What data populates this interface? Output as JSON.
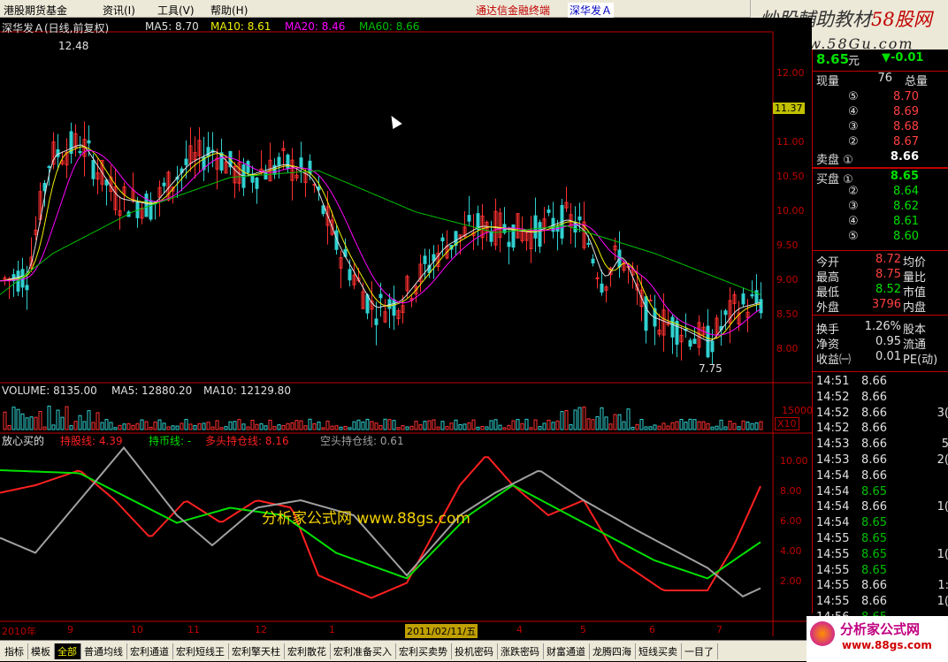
{
  "menu": {
    "items": [
      "港股期货基金",
      "资讯(I)",
      "工具(V)",
      "帮助(H)"
    ],
    "title_left": "通达信金融终端",
    "title_right": "深华发Ａ"
  },
  "brand": {
    "line1": "炒股輔助教材",
    "line2": "58股网",
    "url": "www.58Gu.com"
  },
  "header": {
    "stock": "深华发Ａ(日线,前复权)",
    "ma5": "MA5: 8.70",
    "ma10": "MA10: 8.61",
    "ma20": "MA20: 8.46",
    "ma60": "MA60: 8.66"
  },
  "price_axis": [
    "12.00",
    "11.50",
    "11.00",
    "10.50",
    "10.00",
    "9.50",
    "9.00",
    "8.50",
    "8.00"
  ],
  "price_current_tag": "11.37",
  "price_high": "12.48",
  "price_low": "7.75",
  "volume": {
    "label": "VOLUME: 8135.00",
    "ma5": "MA5: 12880.20",
    "ma10": "MA10: 12129.80",
    "axis": "15000",
    "unit": "X10"
  },
  "indicator": {
    "name": "放心买的",
    "l1": "持股线: 4.39",
    "l2": "持币线: -",
    "l3": "多头持仓线: 8.16",
    "l4": "空头持仓线: 0.61",
    "axis": [
      "10.00",
      "8.00",
      "6.00",
      "4.00",
      "2.00"
    ]
  },
  "watermark": {
    "text": "分析家公式网 www.88gs.com"
  },
  "date_label": "2011/02/11/五",
  "time_axis": [
    "2010年",
    "9",
    "10",
    "11",
    "12",
    "1",
    "3",
    "4",
    "5",
    "6",
    "7"
  ],
  "quote": {
    "price": "8.65",
    "unit": "元",
    "change": "▼-0.01",
    "head": [
      "现量",
      "76",
      "总量"
    ],
    "sell": [
      {
        "n": "⑤",
        "p": "8.70"
      },
      {
        "n": "④",
        "p": "8.69"
      },
      {
        "n": "③",
        "p": "8.68"
      },
      {
        "n": "②",
        "p": "8.67"
      },
      {
        "n": "卖盘 ①",
        "p": "8.66"
      }
    ],
    "buy": [
      {
        "n": "买盘 ①",
        "p": "8.65"
      },
      {
        "n": "②",
        "p": "8.64"
      },
      {
        "n": "③",
        "p": "8.62"
      },
      {
        "n": "④",
        "p": "8.61"
      },
      {
        "n": "⑤",
        "p": "8.60"
      }
    ],
    "stats": [
      {
        "l": "今开",
        "v": "8.72",
        "r": "均价"
      },
      {
        "l": "最高",
        "v": "8.75",
        "r": "量比"
      },
      {
        "l": "最低",
        "v": "8.52",
        "r": "市值"
      },
      {
        "l": "外盘",
        "v": "3796",
        "r": "内盘"
      }
    ],
    "stats2": [
      {
        "l": "换手",
        "v": "1.26%",
        "r": "股本"
      },
      {
        "l": "净资",
        "v": "0.95",
        "r": "流通"
      },
      {
        "l": "收益㈠",
        "v": "0.01",
        "r": "PE(动)"
      }
    ],
    "ticks": [
      {
        "t": "14:51",
        "p": "8.66",
        "c": "#e0e0e0",
        "v": ""
      },
      {
        "t": "14:52",
        "p": "8.66",
        "c": "#e0e0e0",
        "v": ""
      },
      {
        "t": "14:52",
        "p": "8.66",
        "c": "#e0e0e0",
        "v": "3("
      },
      {
        "t": "14:52",
        "p": "8.66",
        "c": "#e0e0e0",
        "v": ""
      },
      {
        "t": "14:53",
        "p": "8.66",
        "c": "#e0e0e0",
        "v": "5"
      },
      {
        "t": "14:53",
        "p": "8.66",
        "c": "#e0e0e0",
        "v": "2("
      },
      {
        "t": "14:54",
        "p": "8.66",
        "c": "#e0e0e0",
        "v": ""
      },
      {
        "t": "14:54",
        "p": "8.65",
        "c": "#00c000",
        "v": ""
      },
      {
        "t": "14:54",
        "p": "8.66",
        "c": "#e0e0e0",
        "v": "1("
      },
      {
        "t": "14:54",
        "p": "8.65",
        "c": "#00c000",
        "v": ""
      },
      {
        "t": "14:55",
        "p": "8.65",
        "c": "#00c000",
        "v": ""
      },
      {
        "t": "14:55",
        "p": "8.65",
        "c": "#00c000",
        "v": "1("
      },
      {
        "t": "14:55",
        "p": "8.65",
        "c": "#00c000",
        "v": ""
      },
      {
        "t": "14:55",
        "p": "8.66",
        "c": "#e0e0e0",
        "v": "1:"
      },
      {
        "t": "14:55",
        "p": "8.66",
        "c": "#e0e0e0",
        "v": "1("
      },
      {
        "t": "14:56",
        "p": "8.65",
        "c": "#00c000",
        "v": ""
      }
    ]
  },
  "tabs": [
    "指标",
    "模板",
    "全部",
    "普通均线",
    "宏利通道",
    "宏利短线王",
    "宏利擎天柱",
    "宏利散花",
    "宏利准备买入",
    "宏利买卖势",
    "投机密码",
    "涨跌密码",
    "财富通道",
    "龙腾四海",
    "短线买卖",
    "一目了"
  ],
  "logo": {
    "text": "分析家公式网",
    "url": "www.88gs.com"
  }
}
